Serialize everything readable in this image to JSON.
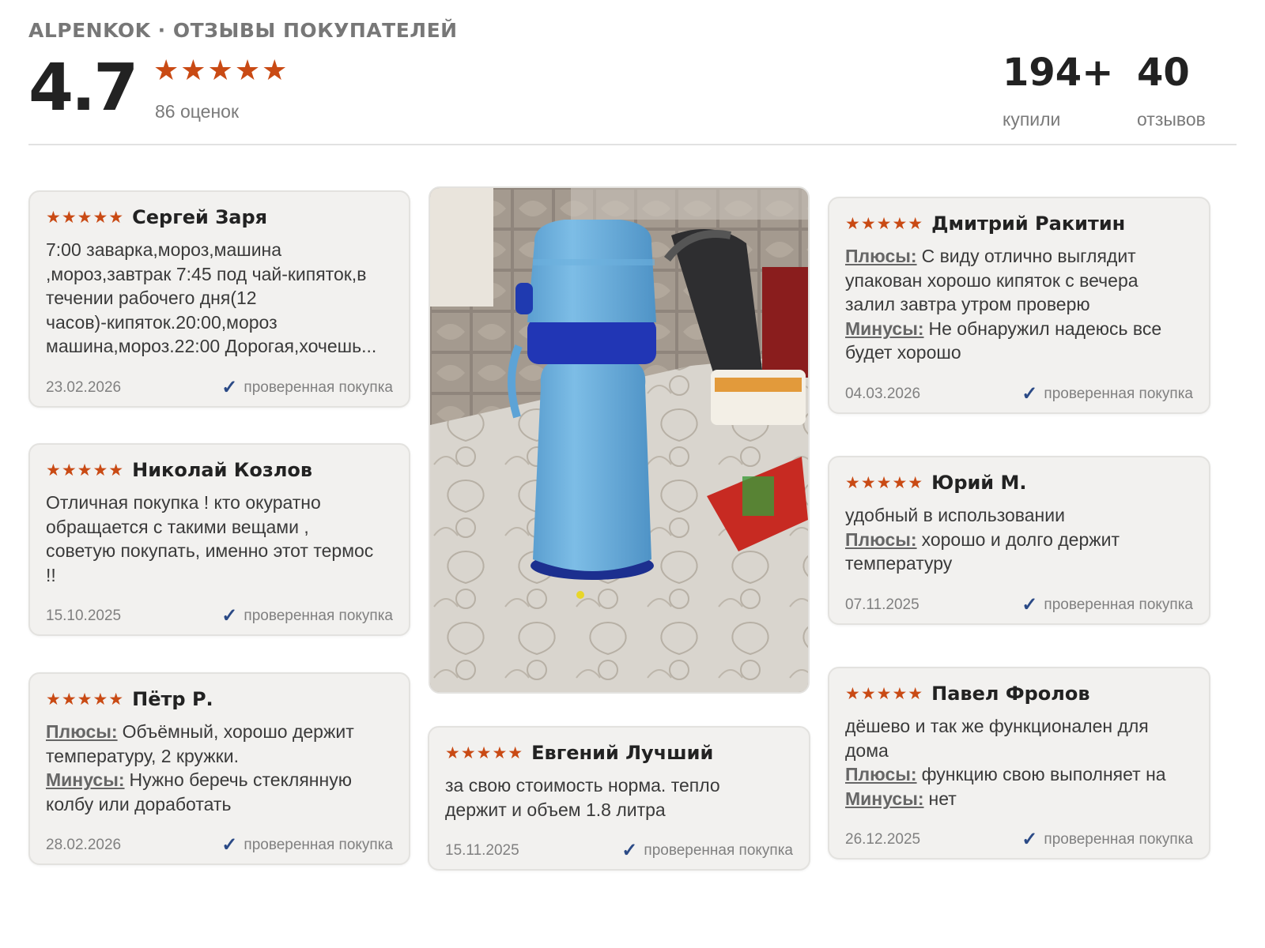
{
  "header": {
    "brand": "ALPENKOK · ОТЗЫВЫ ПОКУПАТЕЛЕЙ",
    "rating": "4.7",
    "stars": "★★★★★",
    "ratings_count": "86 оценок",
    "bought_value": "194+",
    "bought_label": "купили",
    "reviews_value": "40",
    "reviews_label": "отзывов"
  },
  "verified_label": "проверенная покупка",
  "colors": {
    "star": "#c94a14",
    "check": "#2b4a86",
    "card_bg": "#f2f1ef"
  },
  "photo": {
    "alt_icon": "thermos-photo"
  },
  "reviews": [
    {
      "stars": "★★★★★",
      "name": "Сергей Заря",
      "lines": [
        "7:00 заварка,мороз,машина",
        ",мороз,завтрак 7:45 под чай-кипяток,в",
        "течении рабочего дня(12",
        "часов)-кипяток.20:00,мороз",
        "машина,мороз.22:00 Дорогая,хочешь..."
      ],
      "date": "23.02.2026"
    },
    {
      "stars": "★★★★★",
      "name": "Николай Козлов",
      "lines": [
        "Отличная покупка ! кто окуратно",
        "обращается с такими вещами ,",
        "советую покупать, именно этот термос",
        "!!"
      ],
      "date": "15.10.2025"
    },
    {
      "stars": "★★★★★",
      "name": "Пётр Р.",
      "pros_label": "Плюсы:",
      "pros_1": "Объёмный, хорошо держит",
      "pros_2": "температуру, 2 кружки.",
      "cons_label": "Минусы:",
      "cons_1": "Нужно беречь стеклянную",
      "cons_2": "колбу или доработать",
      "date": "28.02.2026"
    },
    {
      "stars": "★★★★★",
      "name": "Евгений Лучший",
      "lines": [
        "за свою стоимость норма. тепло",
        "держит и объем 1.8 литра"
      ],
      "date": "15.11.2025"
    },
    {
      "stars": "★★★★★",
      "name": "Дмитрий Ракитин",
      "pros_label": "Плюсы:",
      "pros_1": "С виду отлично выглядит",
      "pros_2": "упакован хорошо кипяток с вечера",
      "pros_3": "залил завтра утром проверю",
      "cons_label": "Минусы:",
      "cons_1": "Не обнаружил надеюсь все",
      "cons_2": "будет хорошо",
      "date": "04.03.2026"
    },
    {
      "stars": "★★★★★",
      "name": "Юрий М.",
      "text_1": "удобный в использовании",
      "pros_label": "Плюсы:",
      "pros_1": "хорошо и долго держит",
      "pros_2": "температуру",
      "date": "07.11.2025"
    },
    {
      "stars": "★★★★★",
      "name": "Павел Фролов",
      "text_1": "дёшево и так же функционален для",
      "text_2": "дома",
      "pros_label": "Плюсы:",
      "pros_1": "функцию свою выполняет на",
      "cons_label": "Минусы:",
      "cons_1": "нет",
      "date": "26.12.2025"
    }
  ]
}
